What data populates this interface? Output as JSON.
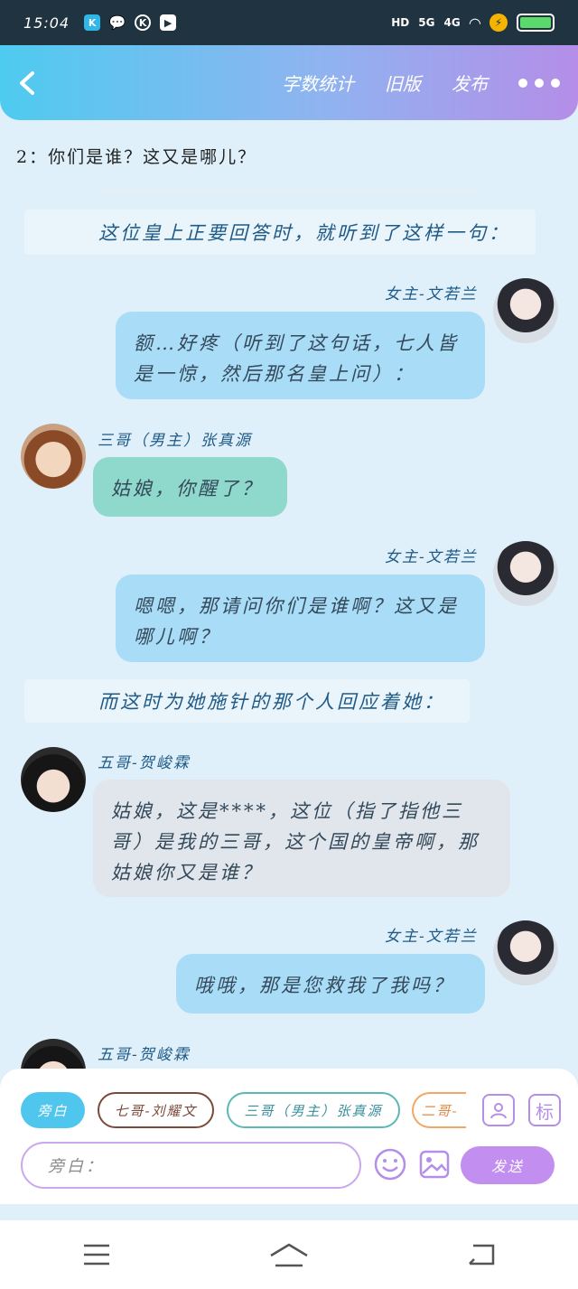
{
  "status_bar": {
    "time": "15:04",
    "apps": [
      "K",
      "wechat-icon",
      "K",
      "video-icon"
    ],
    "network": [
      "HD",
      "5G",
      "4G"
    ],
    "battery_level": 1.0
  },
  "header": {
    "actions": [
      "字数统计",
      "旧版",
      "发布"
    ]
  },
  "content": {
    "top_question": "2：你们是谁？这又是哪儿？",
    "narration_1": "这位皇上正要回答时，就听到了这样一句：",
    "narration_2": "而这时为她施针的那个人回应着她：",
    "messages": [
      {
        "speaker": "女主-文若兰",
        "text": "额…好疼（听到了这句话，七人皆是一惊，然后那名皇上问）：",
        "side": "right"
      },
      {
        "speaker": "三哥（男主）张真源",
        "text": "姑娘，你醒了？",
        "side": "left"
      },
      {
        "speaker": "女主-文若兰",
        "text": "嗯嗯，那请问你们是谁啊？这又是哪儿啊？",
        "side": "right"
      },
      {
        "speaker": "五哥-贺峻霖",
        "text": "姑娘，这是****，这位（指了指他三哥）是我的三哥，这个国的皇帝啊，那姑娘你又是谁？",
        "side": "left"
      },
      {
        "speaker": "女主-文若兰",
        "text": "哦哦，那是您救我了我吗？",
        "side": "right"
      },
      {
        "speaker": "五哥-贺峻霖",
        "text": "",
        "side": "left"
      }
    ]
  },
  "panel": {
    "chips": [
      "旁白",
      "七哥-刘耀文",
      "三哥（男主）张真源",
      "二哥-"
    ],
    "input_placeholder": "旁白：",
    "send_label": "发送",
    "tag_label": "标"
  }
}
